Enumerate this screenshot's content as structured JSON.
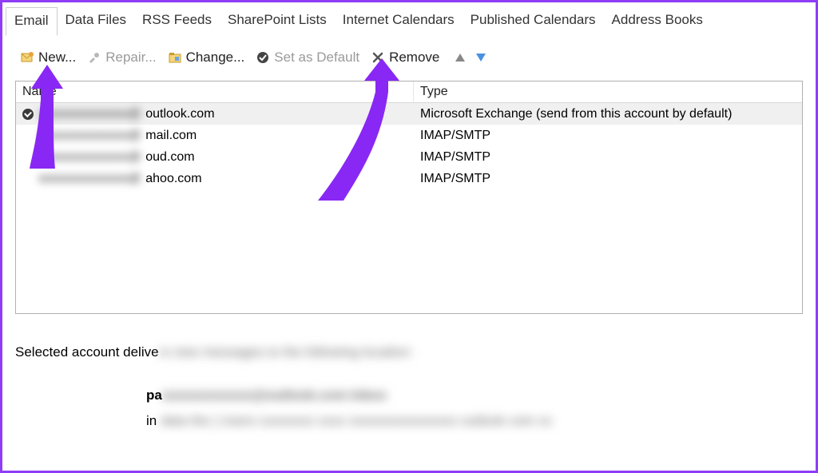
{
  "tabs": [
    "Email",
    "Data Files",
    "RSS Feeds",
    "SharePoint Lists",
    "Internet Calendars",
    "Published Calendars",
    "Address Books"
  ],
  "activeTab": 0,
  "toolbar": {
    "new": "New...",
    "repair": "Repair...",
    "change": "Change...",
    "setDefault": "Set as Default",
    "remove": "Remove"
  },
  "columns": {
    "name": "Name",
    "type": "Type"
  },
  "accounts": [
    {
      "hidden": "xxxxxxxxxxxxxxx@",
      "suffix": "outlook.com",
      "type": "Microsoft Exchange (send from this account by default)",
      "default": true,
      "selected": true
    },
    {
      "hidden": "xxxxxxxxxxxxxxx@",
      "suffix": "mail.com",
      "type": "IMAP/SMTP",
      "default": false,
      "selected": false
    },
    {
      "hidden": "xxxxxxxxxxxxxxx@",
      "suffix": "oud.com",
      "type": "IMAP/SMTP",
      "default": false,
      "selected": false
    },
    {
      "hidden": "xxxxxxxxxxxxxxx@",
      "suffix": "ahoo.com",
      "type": "IMAP/SMTP",
      "default": false,
      "selected": false
    }
  ],
  "selectedInfo": {
    "prefix": "Selected account delive",
    "blur": "rs new messages to the following location:"
  },
  "detail": {
    "boldPrefix": "pa",
    "boldBlur": "xxxxxxxxxxxx@outlook.com Inbox",
    "line2Prefix": "in ",
    "line2Blur": "data the | Users xxxxxxxx xxxx xxxxxxxxxxxxxxxx outlook com xx"
  }
}
